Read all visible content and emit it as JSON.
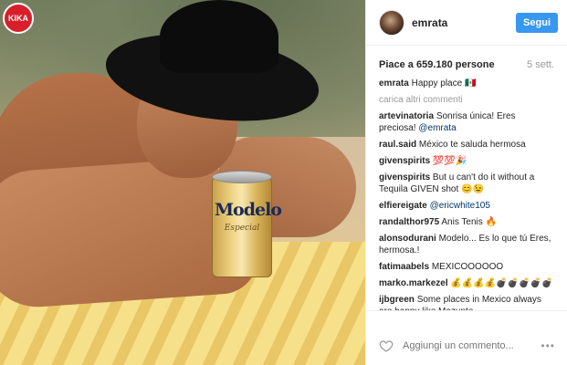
{
  "watermark": {
    "text": "KIKA"
  },
  "photo": {
    "can_brand": "Modelo",
    "can_sub": "Especial"
  },
  "header": {
    "username": "emrata",
    "follow_label": "Segui"
  },
  "meta": {
    "likes": "Piace a 659.180 persone",
    "date": "5 sett."
  },
  "caption": {
    "user": "emrata",
    "text": "Happy place 🇲🇽"
  },
  "load_more": "carica altri commenti",
  "comments": [
    {
      "user": "artevinatoria",
      "text": "Sonrisa única! Eres preciosa! ",
      "mention": "@emrata"
    },
    {
      "user": "raul.said",
      "text": "México te saluda hermosa",
      "mention": ""
    },
    {
      "user": "givenspirits",
      "text": "💯💯🎉",
      "mention": ""
    },
    {
      "user": "givenspirits",
      "text": "But u can't do it without a Tequila GIVEN shot 😊😉",
      "mention": ""
    },
    {
      "user": "elfiereigate",
      "text": "",
      "mention": "@ericwhite105"
    },
    {
      "user": "randalthor975",
      "text": "Anis Tenis 🔥",
      "mention": ""
    },
    {
      "user": "alonsodurani",
      "text": "Modelo... Es lo que tú Eres, hermosa.!",
      "mention": ""
    },
    {
      "user": "fatimaabels",
      "text": "MEXICOOOOOO",
      "mention": ""
    },
    {
      "user": "marko.markezel",
      "text": "💰💰💰💰💣💣💣💣💣",
      "mention": ""
    },
    {
      "user": "ijbgreen",
      "text": "Some places in Mexico always are happy like Mazunte",
      "mention": ""
    }
  ],
  "add_comment": {
    "placeholder": "Aggiungi un commento...",
    "more": "•••"
  }
}
